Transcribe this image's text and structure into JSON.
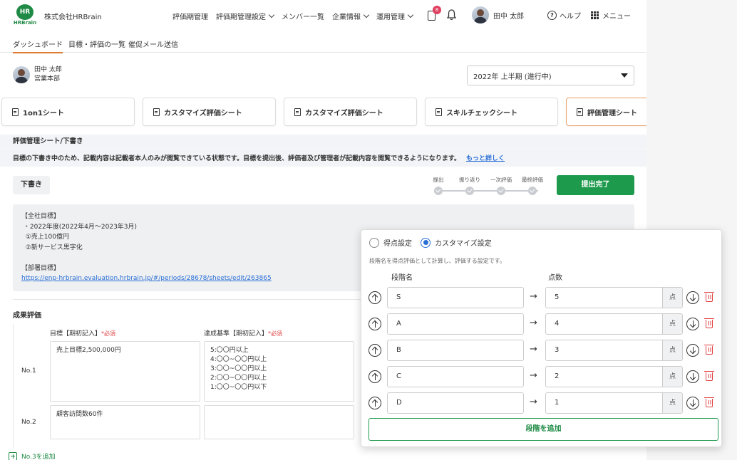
{
  "header": {
    "logo_mark": "HR",
    "logo_word": "HRBrain",
    "company": "株式会社HRBrain",
    "menu": [
      {
        "label": "評価期管理",
        "dropdown": false
      },
      {
        "label": "評価期管理設定",
        "dropdown": true
      },
      {
        "label": "メンバー一覧",
        "dropdown": false
      },
      {
        "label": "企業情報",
        "dropdown": true
      },
      {
        "label": "運用管理",
        "dropdown": true
      }
    ],
    "notification_count": "8",
    "user_name": "田中 太郎",
    "help_label": "ヘルプ",
    "menu_label": "メニュー"
  },
  "subnav": {
    "tabs": [
      "ダッシュボード",
      "目標・評価の一覧",
      "催促メール送信"
    ]
  },
  "profile": {
    "name": "田中 太郎",
    "department": "営業本部"
  },
  "period_select": {
    "value": "2022年 上半期 (進行中)"
  },
  "sheet_tabs": [
    "1on1シート",
    "カスタマイズ評価シート",
    "カスタマイズ評価シート",
    "スキルチェックシート",
    "評価管理シート"
  ],
  "section": {
    "title": "評価管理シート/下書き",
    "notice": "目標の下書き中のため、記載内容は記載者本人のみが閲覧できている状態です。目標を提出後、評価者及び管理者が記載内容を閲覧できるようになります。",
    "notice_link": "もっと詳しく"
  },
  "status": {
    "draft_label": "下書き",
    "steps": [
      "提出",
      "振り返り",
      "一次評価",
      "最終評価"
    ],
    "submit_label": "提出完了"
  },
  "goals": {
    "lines": [
      "【全社目標】",
      " ・2022年度(2022年4月〜2023年3月)",
      "  ①売上100億円",
      "  ②新サービス黒字化",
      "",
      "【部署目標】"
    ],
    "link": "https://enp-hrbrain.evaluation.hrbrain.jp/#/periods/28678/sheets/edit/263865"
  },
  "results": {
    "title": "成果評価",
    "col1": "目標【期初記入】",
    "col2": "達成基準【期初記入】",
    "required": "*必須",
    "rows": [
      {
        "label": "No.1",
        "goal": "売上目標2,500,000円",
        "criteria": [
          "5:〇〇円以上",
          "4:〇〇~〇〇円以上",
          "3:〇〇~〇〇円以上",
          "2:〇〇~〇〇円以上",
          "1:〇〇~〇〇円以下"
        ]
      },
      {
        "label": "No.2",
        "goal": "顧客訪問数60件",
        "criteria": []
      }
    ],
    "add_label": "No.3を追加"
  },
  "popup": {
    "option_score": "得点設定",
    "option_custom": "カスタマイズ設定",
    "selected": "カスタマイズ設定",
    "note": "段階名を得点評価として計算し、評価する設定です。",
    "col_name": "段階名",
    "col_score": "点数",
    "unit": "点",
    "arrow": "→",
    "stages": [
      {
        "name": "S",
        "score": "5"
      },
      {
        "name": "A",
        "score": "4"
      },
      {
        "name": "B",
        "score": "3"
      },
      {
        "name": "C",
        "score": "2"
      },
      {
        "name": "D",
        "score": "1"
      }
    ],
    "add_label": "段階を追加"
  },
  "colors": {
    "brand_green": "#1e8a45",
    "accent_blue": "#2a6fd6",
    "required_red": "#e04040",
    "tab_accent": "#e07a30"
  }
}
